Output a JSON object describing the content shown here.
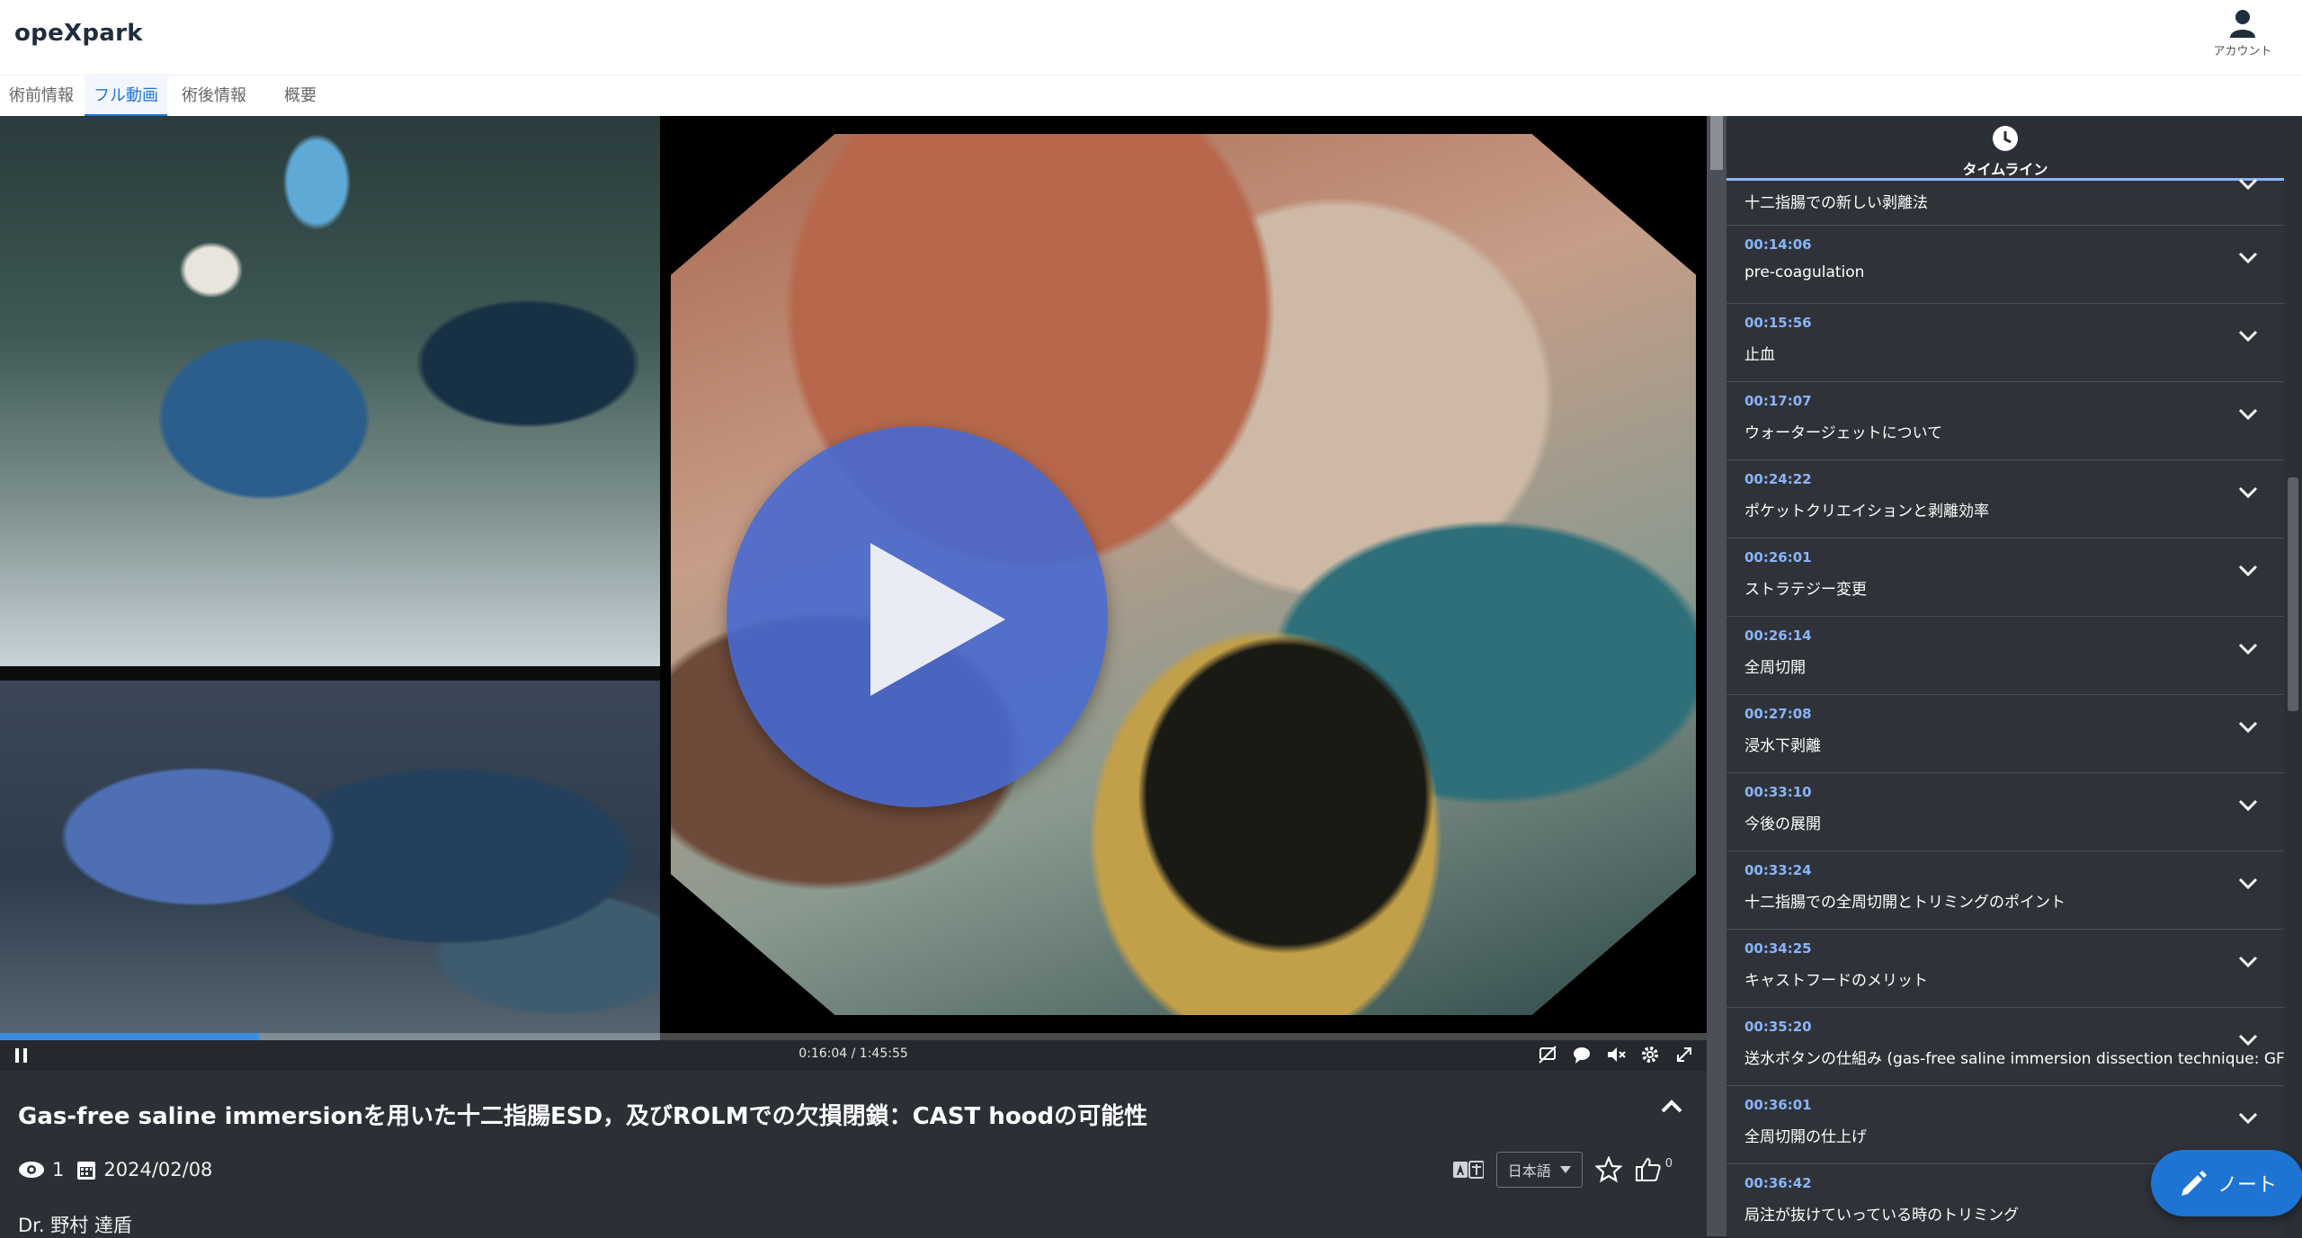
{
  "app": {
    "logo": "opeXpark",
    "account_label": "アカウント"
  },
  "tabs": [
    {
      "label": "術前情報",
      "active": false
    },
    {
      "label": "フル動画",
      "active": true
    },
    {
      "label": "術後情報",
      "active": false
    },
    {
      "label": "概要",
      "active": false
    }
  ],
  "player": {
    "time_display": "0:16:04 / 1:45:55",
    "progress": 0.1517,
    "state": "paused-overlay",
    "icons": [
      "pause-icon",
      "hide-comments-icon",
      "comment-icon",
      "mute-icon",
      "settings-icon",
      "fullscreen-icon"
    ]
  },
  "video": {
    "title": "Gas-free saline immersionを用いた十二指腸ESD，及びROLMでの欠損閉鎖：CAST hoodの可能性",
    "views": "1",
    "date": "2024/02/08",
    "doctor": "Dr. 野村 達盾",
    "language": "日本語",
    "likes": "0"
  },
  "timeline": {
    "header": "タイムライン",
    "items": [
      {
        "time": "",
        "label": "十二指腸での新しい剥離法",
        "partial": true
      },
      {
        "time": "00:14:06",
        "label": "pre-coagulation"
      },
      {
        "time": "00:15:56",
        "label": "止血"
      },
      {
        "time": "00:17:07",
        "label": "ウォータージェットについて"
      },
      {
        "time": "00:24:22",
        "label": "ポケットクリエイションと剥離効率"
      },
      {
        "time": "00:26:01",
        "label": "ストラテジー変更"
      },
      {
        "time": "00:26:14",
        "label": "全周切開"
      },
      {
        "time": "00:27:08",
        "label": "浸水下剥離"
      },
      {
        "time": "00:33:10",
        "label": "今後の展開"
      },
      {
        "time": "00:33:24",
        "label": "十二指腸での全周切開とトリミングのポイント"
      },
      {
        "time": "00:34:25",
        "label": "キャストフードのメリット"
      },
      {
        "time": "00:35:20",
        "label": "送水ボタンの仕組み (gas-free saline immersion dissection technique: GFI)"
      },
      {
        "time": "00:36:01",
        "label": "全周切開の仕上げ"
      },
      {
        "time": "00:36:42",
        "label": "局注が抜けていっている時のトリミング"
      }
    ]
  },
  "note_button": {
    "label": "ノート"
  },
  "colors": {
    "accent": "#1e74d3",
    "timeline_time": "#8ab4f8",
    "panel_bg": "#2b2f36",
    "play_button": "#4669d2"
  }
}
